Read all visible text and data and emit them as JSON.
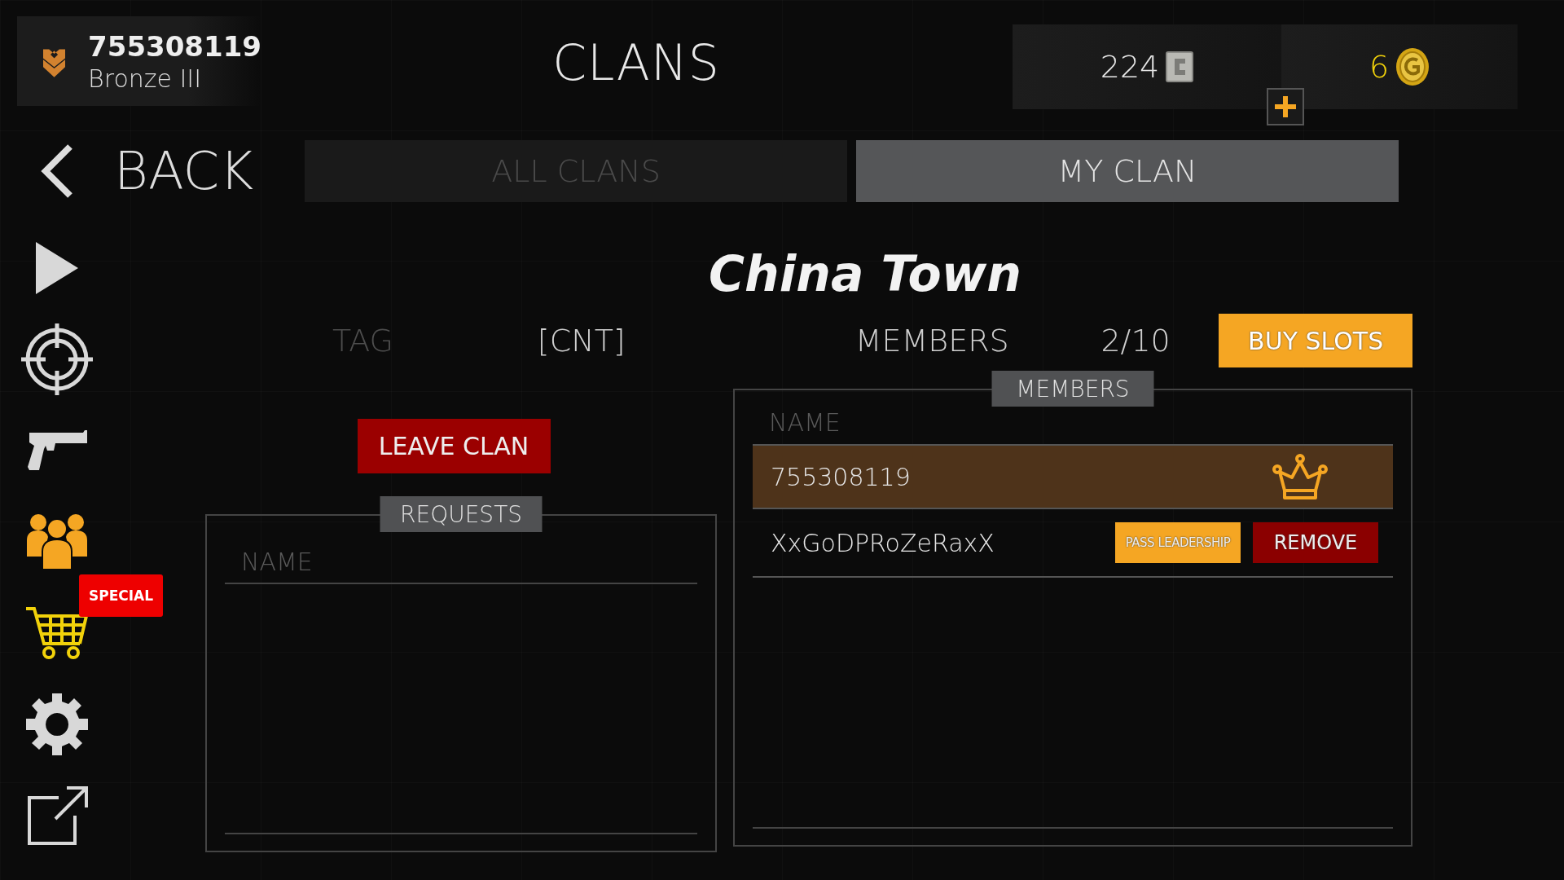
{
  "profile": {
    "player_id": "755308119",
    "rank": "Bronze III"
  },
  "title": "CLANS",
  "currencies": [
    {
      "kind": "cash",
      "amount": "224"
    },
    {
      "kind": "gold",
      "amount": "6"
    }
  ],
  "back": {
    "label": "BACK"
  },
  "tabs": [
    {
      "label": "ALL CLANS",
      "selected": false
    },
    {
      "label": "MY CLAN",
      "selected": true
    }
  ],
  "sidebar": [
    {
      "kind": "play",
      "selected": false
    },
    {
      "kind": "target",
      "selected": false
    },
    {
      "kind": "pistol",
      "selected": false
    },
    {
      "kind": "clan",
      "selected": true
    },
    {
      "kind": "shop",
      "selected": false,
      "badge": "SPECIAL"
    },
    {
      "kind": "settings",
      "selected": false
    },
    {
      "kind": "external",
      "selected": false
    }
  ],
  "clan": {
    "name": "China Town",
    "tag_label": "TAG",
    "tag": "[CNT]",
    "members_label": "MEMBERS",
    "members_count": "2/10",
    "buy_slots": "BUY SLOTS",
    "leave": "LEAVE CLAN"
  },
  "requests": {
    "title": "REQUESTS",
    "columns": [
      "NAME"
    ]
  },
  "members": {
    "title": "MEMBERS",
    "columns": [
      "NAME"
    ],
    "rows": [
      {
        "name": "755308119",
        "leader": true,
        "selected": true
      },
      {
        "name": "XxGoDPRoZeRaxX",
        "leader": false,
        "selected": false,
        "actions": [
          {
            "kind": "pass",
            "label": "PASS LEADERSHIP"
          },
          {
            "kind": "remove",
            "label": "REMOVE"
          }
        ]
      }
    ]
  }
}
